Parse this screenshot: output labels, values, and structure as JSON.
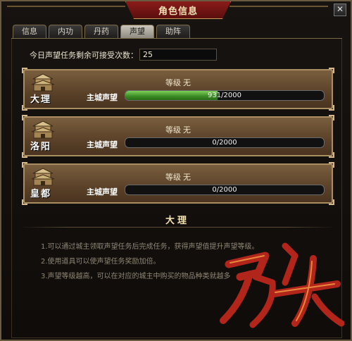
{
  "window": {
    "title": "角色信息",
    "close_label": "✕"
  },
  "tabs": [
    {
      "label": "信息",
      "active": false
    },
    {
      "label": "内功",
      "active": false
    },
    {
      "label": "丹药",
      "active": false
    },
    {
      "label": "声望",
      "active": true
    },
    {
      "label": "助阵",
      "active": false
    }
  ],
  "remaining": {
    "label": "今日声望任务剩余可接受次数：",
    "value": "25"
  },
  "cities": [
    {
      "name": "大理",
      "level_label": "等级",
      "level_value": "无",
      "rep_label": "主城声望",
      "progress_text": "931/2000",
      "current": 931,
      "max": 2000
    },
    {
      "name": "洛阳",
      "level_label": "等级",
      "level_value": "无",
      "rep_label": "主城声望",
      "progress_text": "0/2000",
      "current": 0,
      "max": 2000
    },
    {
      "name": "皇都",
      "level_label": "等级",
      "level_value": "无",
      "rep_label": "主城声望",
      "progress_text": "0/2000",
      "current": 0,
      "max": 2000
    }
  ],
  "selected_city": "大理",
  "tips": [
    "1.可以通过城主领取声望任务后完成任务，获得声望值提升声望等级。",
    "2.使用道具可以使声望任务奖励加倍。",
    "3.声望等级越高，可以在对应的城主中购买的物品种类就越多"
  ],
  "colors": {
    "progress_fill": "#4a9a2e",
    "title_banner": "#7a1816",
    "panel": "#5a4128"
  }
}
